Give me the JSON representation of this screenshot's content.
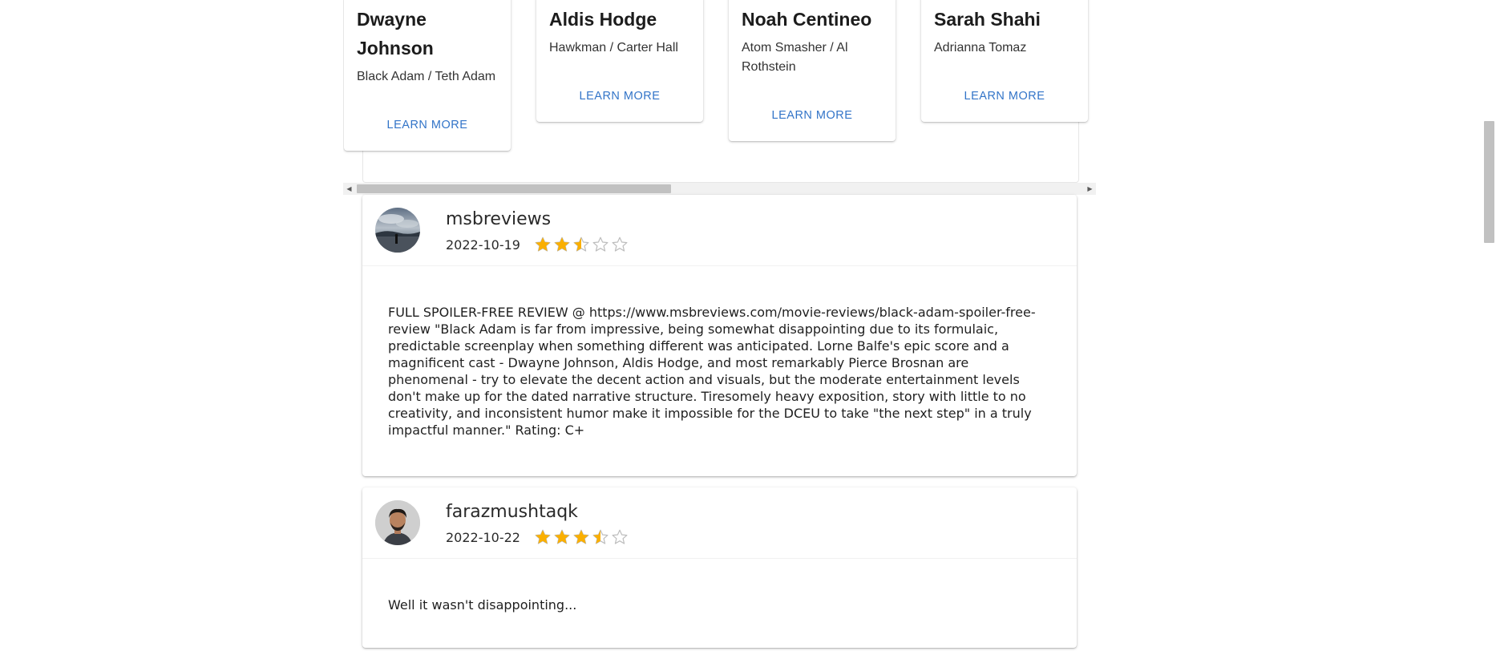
{
  "cast": [
    {
      "name": "Dwayne Johnson",
      "role": "Black Adam / Teth Adam",
      "button": "LEARN MORE"
    },
    {
      "name": "Aldis Hodge",
      "role": "Hawkman / Carter Hall",
      "button": "LEARN MORE"
    },
    {
      "name": "Noah Centineo",
      "role": "Atom Smasher / Al Rothstein",
      "button": "LEARN MORE"
    },
    {
      "name": "Sarah Shahi",
      "role": "Adrianna Tomaz",
      "button": "LEARN MORE"
    }
  ],
  "reviews": [
    {
      "author": "msbreviews",
      "date": "2022-10-19",
      "rating": 2.5,
      "max_rating": 5,
      "text": "FULL SPOILER-FREE REVIEW @ https://www.msbreviews.com/movie-reviews/black-adam-spoiler-free-review \"Black Adam is far from impressive, being somewhat disappointing due to its formulaic, predictable screenplay when something different was anticipated. Lorne Balfe's epic score and a magnificent cast - Dwayne Johnson, Aldis Hodge, and most remarkably Pierce Brosnan are phenomenal - try to elevate the decent action and visuals, but the moderate entertainment levels don't make up for the dated narrative structure. Tiresomely heavy exposition, story with little to no creativity, and inconsistent humor make it impossible for the DCEU to take \"the next step\" in a truly impactful manner.\" Rating: C+"
    },
    {
      "author": "farazmushtaqk",
      "date": "2022-10-22",
      "rating": 3.5,
      "max_rating": 5,
      "text": "Well it wasn't disappointing..."
    }
  ],
  "colors": {
    "link": "#3274c8",
    "star_filled": "#faaf00",
    "star_empty": "#bdbdbd"
  }
}
